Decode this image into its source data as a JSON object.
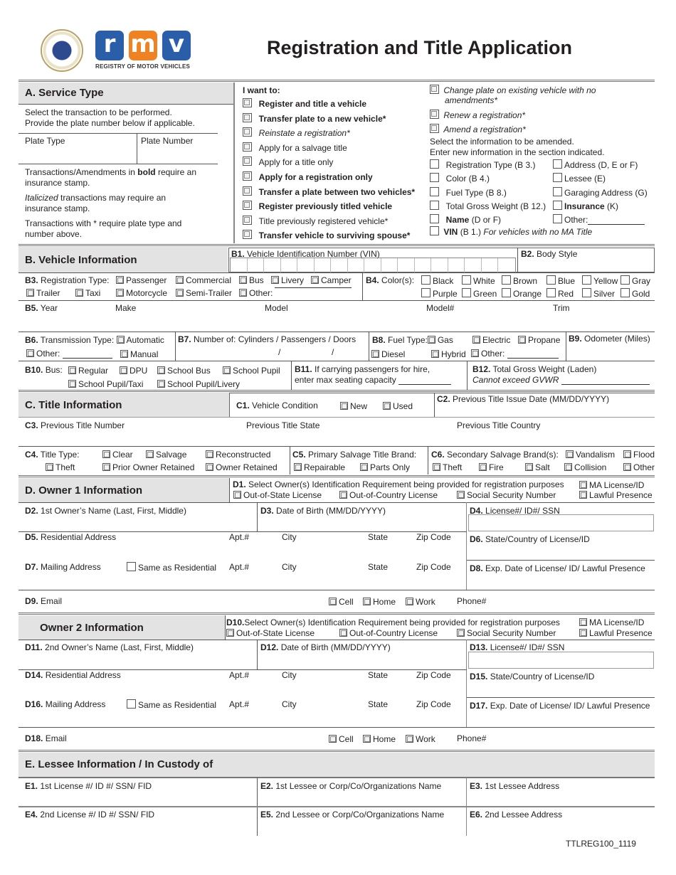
{
  "header": {
    "title": "Registration and Title Application",
    "logo": {
      "letters": [
        "r",
        "m",
        "v"
      ],
      "subtitle": "REGISTRY OF MOTOR VEHICLES",
      "colors": {
        "r": "#2a5ea8",
        "m": "#ef8223",
        "v": "#2a5ea8"
      }
    },
    "seal_icon": "state-seal-icon"
  },
  "sectionA": {
    "title": "A. Service Type",
    "instructions": [
      "Select the transaction to be performed.",
      "Provide the plate number below if applicable."
    ],
    "plate_type_label": "Plate Type",
    "plate_number_label": "Plate Number",
    "note1_pre": "Transactions/Amendments in ",
    "note1_bold": "bold",
    "note1_post": " require an",
    "note1_line2": "insurance stamp.",
    "note2_italic": "Italicized",
    "note2_post": " transactions may require an",
    "note2_line2": "insurance stamp.",
    "note3": "Transactions with * require plate type and",
    "note3_line2": "number above.",
    "i_want_to": "I want to:",
    "options": [
      {
        "label": "Register and title a vehicle",
        "style": "bold"
      },
      {
        "label": "Transfer plate to a new vehicle*",
        "style": "bold"
      },
      {
        "label": "Reinstate a registration*",
        "style": "italic"
      },
      {
        "label": "Apply for a salvage title",
        "style": "normal"
      },
      {
        "label": "Apply for a title only",
        "style": "normal"
      },
      {
        "label": "Apply for a registration only",
        "style": "bold"
      },
      {
        "label": "Transfer a plate between two vehicles*",
        "style": "bold"
      },
      {
        "label": "Register previously titled vehicle",
        "style": "bold"
      },
      {
        "label": "Title previously registered vehicle*",
        "style": "normal"
      },
      {
        "label": "Transfer vehicle to surviving spouse*",
        "style": "bold"
      }
    ],
    "right_options": [
      {
        "label": "Change plate on existing vehicle with no",
        "line2": "amendments*"
      },
      {
        "label": "Renew a registration*"
      },
      {
        "label": "Amend a registration*"
      }
    ],
    "amend_instructions": [
      "Select the information to be amended.",
      "Enter new information in the section indicated."
    ],
    "amend_left": [
      {
        "bold": "",
        "label": "Registration Type (B 3.)"
      },
      {
        "bold": "",
        "label": "Color (B 4.)"
      },
      {
        "bold": "",
        "label": "Fuel Type (B 8.)"
      },
      {
        "bold": "",
        "label": "Total Gross Weight (B 12.)"
      },
      {
        "bold": "Name",
        "label": " (D or F)"
      }
    ],
    "amend_right": [
      {
        "bold": "",
        "label": "Address (D, E or F)"
      },
      {
        "bold": "",
        "label": "Lessee (E)"
      },
      {
        "bold": "",
        "label": "Garaging Address (G)"
      },
      {
        "bold": "Insurance",
        "label": " (K)"
      },
      {
        "bold": "",
        "label": "Other:"
      }
    ],
    "amend_vin": {
      "bold": "VIN",
      "label": " (B 1.) ",
      "italic": "For vehicles with no MA Title"
    }
  },
  "sectionB": {
    "title": "B. Vehicle Information",
    "b1": {
      "code": "B1.",
      "label": " Vehicle Identification Number (VIN)",
      "cells": 17
    },
    "b2": {
      "code": "B2.",
      "label": " Body Style"
    },
    "b3": {
      "code": "B3.",
      "label": " Registration Type:",
      "row1": [
        "Passenger",
        "Commercial",
        "Bus",
        "Livery",
        "Camper"
      ],
      "row2": [
        "Trailer",
        "Taxi",
        "Motorcycle",
        "Semi-Trailer",
        "Other:"
      ]
    },
    "b4": {
      "code": "B4.",
      "label": " Color(s):",
      "row1": [
        "Black",
        "White",
        "Brown",
        "Blue",
        "Yellow",
        "Gray"
      ],
      "row2": [
        "Purple",
        "Green",
        "Orange",
        "Red",
        "Silver",
        "Gold"
      ]
    },
    "b5": {
      "code": "B5.",
      "label": " Year",
      "make": "Make",
      "model": "Model",
      "model_num": "Model#",
      "trim": "Trim"
    },
    "b6": {
      "code": "B6.",
      "label": " Transmission Type:",
      "automatic": "Automatic",
      "other": "Other:",
      "manual": "Manual"
    },
    "b7": {
      "code": "B7.",
      "label": " Number of: Cylinders / Passengers / Doors",
      "sep": "/"
    },
    "b8": {
      "code": "B8.",
      "label": " Fuel Type:",
      "gas": "Gas",
      "electric": "Electric",
      "propane": "Propane",
      "diesel": "Diesel",
      "hybrid": "Hybrid",
      "other": "Other:"
    },
    "b9": {
      "code": "B9.",
      "label": " Odometer (Miles)"
    },
    "b10": {
      "code": "B10.",
      "label": " Bus:",
      "row1": [
        "Regular",
        "DPU",
        "School Bus",
        "School Pupil"
      ],
      "row2": [
        "School Pupil/Taxi",
        "School Pupil/Livery"
      ]
    },
    "b11": {
      "code": "B11.",
      "label": " If carrying passengers for hire,",
      "line2": "enter max seating capacity"
    },
    "b12": {
      "code": "B12.",
      "label": " Total Gross Weight (Laden)",
      "line2": "Cannot exceed GVWR"
    }
  },
  "sectionC": {
    "title": "C. Title Information",
    "c1": {
      "code": "C1.",
      "label": " Vehicle Condition",
      "new": "New",
      "used": "Used"
    },
    "c2": {
      "code": "C2.",
      "label": " Previous Title Issue Date (MM/DD/YYYY)"
    },
    "c3": {
      "code": "C3.",
      "label": " Previous Title Number",
      "state": "Previous Title State",
      "country": "Previous Title Country"
    },
    "c4": {
      "code": "C4.",
      "label": " Title Type:",
      "row1": [
        "Clear",
        "Salvage",
        "Reconstructed"
      ],
      "row2": [
        "Theft",
        "Prior Owner Retained",
        "Owner Retained"
      ]
    },
    "c5": {
      "code": "C5.",
      "label": " Primary Salvage Title Brand:",
      "options": [
        "Repairable",
        "Parts Only"
      ]
    },
    "c6": {
      "code": "C6.",
      "label": " Secondary Salvage Brand(s):",
      "row1": [
        "Vandalism",
        "Flood"
      ],
      "row2": [
        "Theft",
        "Fire",
        "Salt",
        "Collision",
        "Other"
      ]
    }
  },
  "sectionD": {
    "title": "D. Owner 1 Information",
    "d1": {
      "code": "D1.",
      "label": " Select Owner(s) Identification Requirement being provided for registration purposes",
      "options": [
        "MA License/ID",
        "Out-of-State License",
        "Out-of-Country License",
        "Social Security Number",
        "Lawful Presence"
      ]
    },
    "d2": {
      "code": "D2.",
      "label": " 1st Owner’s Name (Last, First, Middle)"
    },
    "d3": {
      "code": "D3.",
      "label": " Date of Birth (MM/DD/YYYY)"
    },
    "d4": {
      "code": "D4.",
      "label": " License#/ ID#/ SSN"
    },
    "d5": {
      "code": "D5.",
      "label": " Residential Address",
      "apt": "Apt.#",
      "city": "City",
      "state": "State",
      "zip": "Zip Code"
    },
    "d6": {
      "code": "D6.",
      "label": " State/Country of License/ID"
    },
    "d7": {
      "code": "D7.",
      "label": " Mailing Address",
      "same": "Same as Residential",
      "apt": "Apt.#",
      "city": "City",
      "state": "State",
      "zip": "Zip Code"
    },
    "d8": {
      "code": "D8.",
      "label": " Exp. Date of License/ ID/ Lawful Presence"
    },
    "d9": {
      "code": "D9.",
      "label": " Email",
      "cell": "Cell",
      "home": "Home",
      "work": "Work",
      "phone": "Phone#"
    }
  },
  "owner2": {
    "title": "Owner 2 Information",
    "d10": {
      "code": "D10.",
      "label": "Select Owner(s) Identification Requirement being provided for registration purposes",
      "options": [
        "MA License/ID",
        "Out-of-State License",
        "Out-of-Country License",
        "Social Security Number",
        "Lawful Presence"
      ]
    },
    "d11": {
      "code": "D11.",
      "label": " 2nd Owner’s Name (Last, First, Middle)"
    },
    "d12": {
      "code": "D12.",
      "label": " Date of Birth (MM/DD/YYYY)"
    },
    "d13": {
      "code": "D13.",
      "label": " License#/ ID#/ SSN"
    },
    "d14": {
      "code": "D14.",
      "label": " Residential Address",
      "apt": "Apt.#",
      "city": "City",
      "state": "State",
      "zip": "Zip Code"
    },
    "d15": {
      "code": "D15.",
      "label": " State/Country of License/ID"
    },
    "d16": {
      "code": "D16.",
      "label": " Mailing Address",
      "same": "Same as Residential",
      "apt": "Apt.#",
      "city": "City",
      "state": "State",
      "zip": "Zip Code"
    },
    "d17": {
      "code": "D17.",
      "label": " Exp. Date of License/ ID/ Lawful Presence"
    },
    "d18": {
      "code": "D18.",
      "label": " Email",
      "cell": "Cell",
      "home": "Home",
      "work": "Work",
      "phone": "Phone#"
    }
  },
  "sectionE": {
    "title": "E. Lessee Information / In Custody of",
    "e1": {
      "code": "E1.",
      "label": " 1st License #/ ID #/ SSN/ FID"
    },
    "e2": {
      "code": "E2.",
      "label": " 1st Lessee or Corp/Co/Organizations Name"
    },
    "e3": {
      "code": "E3.",
      "label": " 1st Lessee Address"
    },
    "e4": {
      "code": "E4.",
      "label": " 2nd License #/ ID #/ SSN/ FID"
    },
    "e5": {
      "code": "E5.",
      "label": " 2nd Lessee or Corp/Co/Organizations Name"
    },
    "e6": {
      "code": "E6.",
      "label": " 2nd Lessee Address"
    }
  },
  "footer": {
    "form_id": "TTLREG100_1119"
  }
}
